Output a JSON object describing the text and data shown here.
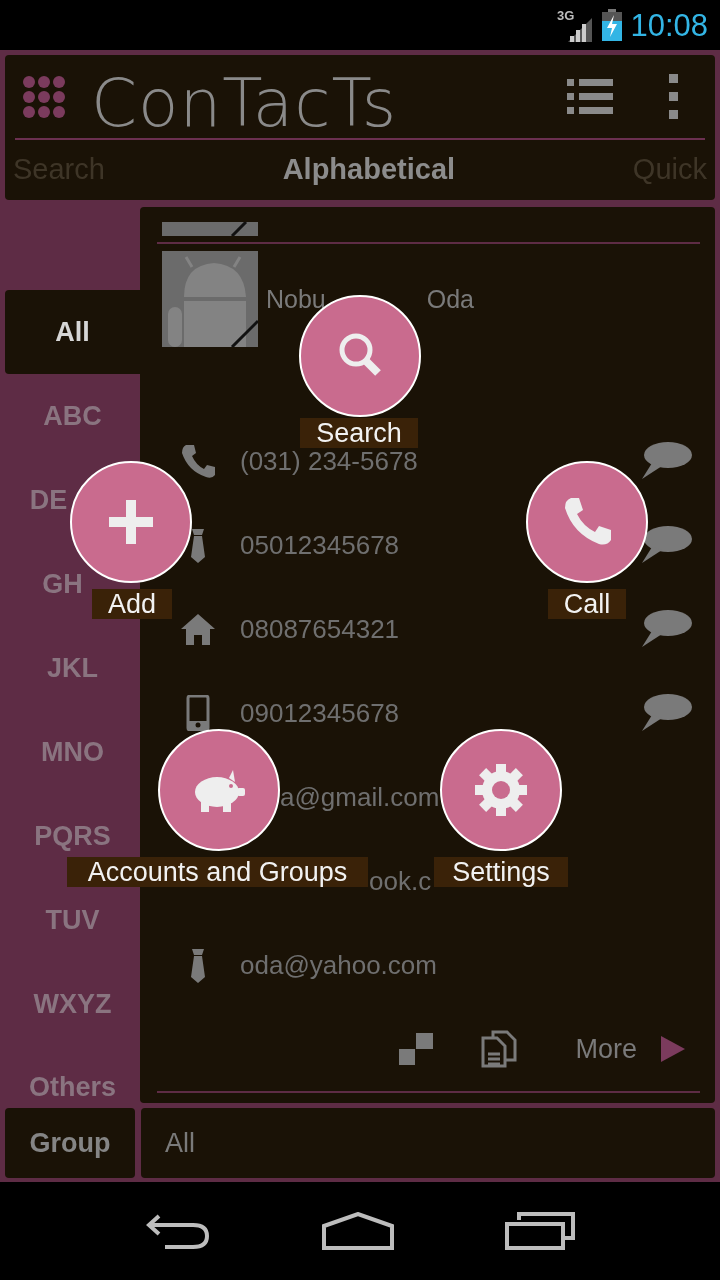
{
  "status_bar": {
    "network": "3G",
    "time": "10:08"
  },
  "app": {
    "title": "ConTacTs"
  },
  "tabs": [
    {
      "label": "Search",
      "selected": false
    },
    {
      "label": "Alphabetical",
      "selected": true
    },
    {
      "label": "Quick",
      "selected": false
    }
  ],
  "index": [
    {
      "label": "All",
      "selected": true
    },
    {
      "label": "ABC",
      "selected": false
    },
    {
      "label": "DE",
      "selected": false
    },
    {
      "label": "GH",
      "selected": false
    },
    {
      "label": "JKL",
      "selected": false
    },
    {
      "label": "MNO",
      "selected": false
    },
    {
      "label": "PQRS",
      "selected": false
    },
    {
      "label": "TUV",
      "selected": false
    },
    {
      "label": "WXYZ",
      "selected": false
    },
    {
      "label": "Others",
      "selected": false
    }
  ],
  "contact": {
    "name_parts": [
      "Nobu",
      "Oda"
    ],
    "details": [
      {
        "kind": "phone",
        "value": "(031) 234-5678",
        "message": true
      },
      {
        "kind": "work",
        "value": "05012345678",
        "message": true
      },
      {
        "kind": "home",
        "value": "08087654321",
        "message": true
      },
      {
        "kind": "mobile",
        "value": "09012345678",
        "message": true
      },
      {
        "value": "a@gmail.com",
        "message": false
      },
      {
        "value": "ook.c",
        "message": false
      },
      {
        "kind": "work",
        "value": "oda@yahoo.com",
        "message": false
      }
    ]
  },
  "footer": {
    "more": "More"
  },
  "group": {
    "label": "Group",
    "value": "All"
  },
  "menu": [
    {
      "kind": "search",
      "label": "Search"
    },
    {
      "kind": "add",
      "label": "Add"
    },
    {
      "kind": "call",
      "label": "Call"
    },
    {
      "kind": "accounts",
      "label": "Accounts and Groups"
    },
    {
      "kind": "settings",
      "label": "Settings"
    }
  ]
}
